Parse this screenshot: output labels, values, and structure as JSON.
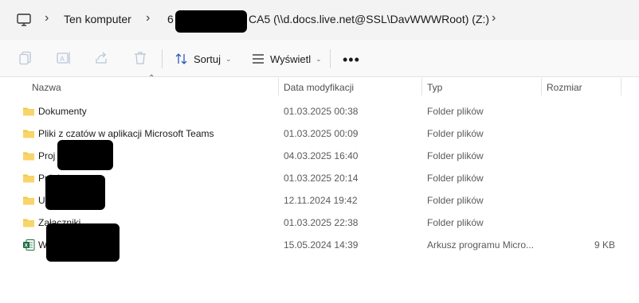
{
  "address_bar": {
    "pc_icon": "computer-icon",
    "crumb_1": "Ten komputer",
    "crumb_2_visible_start": "6",
    "crumb_2_visible_end": "CA5 (\\\\d.docs.live.net@SSL\\DavWWWRoot) (Z:)",
    "separator": "›"
  },
  "toolbar": {
    "icons": [
      "copy-icon",
      "rename-icon",
      "share-icon",
      "delete-icon"
    ],
    "sort_label": "Sortuj",
    "view_label": "Wyświetl",
    "more": "•••"
  },
  "columns": {
    "name": "Nazwa",
    "date": "Data modyfikacji",
    "type": "Typ",
    "size": "Rozmiar"
  },
  "rows": [
    {
      "name": "Dokumenty",
      "date": "01.03.2025 00:38",
      "type": "Folder plików",
      "size": "",
      "icon": "folder-icon"
    },
    {
      "name": "Pliki z czatów w aplikacji Microsoft Teams",
      "date": "01.03.2025 00:09",
      "type": "Folder plików",
      "size": "",
      "icon": "folder-icon"
    },
    {
      "name": "Proj",
      "date": "04.03.2025 16:40",
      "type": "Folder plików",
      "size": "",
      "icon": "folder-icon"
    },
    {
      "name": "Pulpit",
      "date": "01.03.2025 20:14",
      "type": "Folder plików",
      "size": "",
      "icon": "folder-icon"
    },
    {
      "name": "U",
      "date": "12.11.2024 19:42",
      "type": "Folder plików",
      "size": "",
      "icon": "folder-icon"
    },
    {
      "name": "Załączniki",
      "date": "01.03.2025 22:38",
      "type": "Folder plików",
      "size": "",
      "icon": "folder-icon"
    },
    {
      "name": "W",
      "date": "15.05.2024 14:39",
      "type": "Arkusz programu Micro...",
      "size": "9 KB",
      "icon": "excel-file-icon"
    }
  ],
  "colors": {
    "folder": "#f4c542",
    "excel": "#1d6f42",
    "address_bg": "#f3f3f3",
    "toolbar_bg": "#f9f9f9"
  }
}
